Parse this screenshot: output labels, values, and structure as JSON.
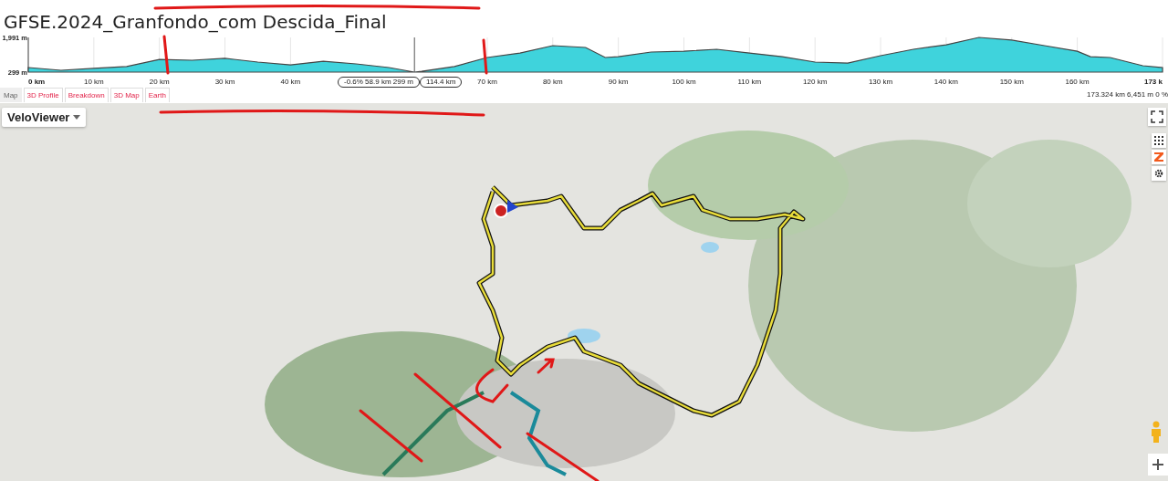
{
  "title": "GFSE.2024_Granfondo_com Descida_Final",
  "elevation_profile": {
    "chart_data": {
      "type": "area",
      "x": [
        0,
        5,
        10,
        15,
        20,
        25,
        30,
        35,
        40,
        45,
        50,
        55,
        58.9,
        60,
        65,
        70,
        75,
        80,
        85,
        88,
        90,
        95,
        100,
        105,
        110,
        115,
        120,
        125,
        130,
        135,
        140,
        145,
        150,
        155,
        160,
        162,
        165,
        170,
        173
      ],
      "series": [
        {
          "color": "#3fd3dc",
          "values": [
            520,
            390,
            480,
            570,
            920,
            880,
            970,
            790,
            650,
            830,
            700,
            520,
            299,
            340,
            570,
            1010,
            1230,
            1590,
            1500,
            1010,
            1050,
            1280,
            1320,
            1410,
            1230,
            1050,
            790,
            740,
            1100,
            1410,
            1630,
            1991,
            1860,
            1590,
            1320,
            1050,
            1010,
            610,
            520
          ]
        }
      ],
      "grid": true,
      "xlim": [
        0,
        173
      ],
      "ylim": [
        299,
        1991
      ],
      "xticks": [
        {
          "value": 0,
          "label": "0 km"
        },
        {
          "value": 10,
          "label": "10 km"
        },
        {
          "value": 20,
          "label": "20 km"
        },
        {
          "value": 30,
          "label": "30 km"
        },
        {
          "value": 40,
          "label": "40 km"
        },
        {
          "value": 70,
          "label": "70 km"
        },
        {
          "value": 80,
          "label": "80 km"
        },
        {
          "value": 90,
          "label": "90 km"
        },
        {
          "value": 100,
          "label": "100 km"
        },
        {
          "value": 110,
          "label": "110 km"
        },
        {
          "value": 120,
          "label": "120 km"
        },
        {
          "value": 130,
          "label": "130 km"
        },
        {
          "value": 140,
          "label": "140 km"
        },
        {
          "value": 150,
          "label": "150 km"
        },
        {
          "value": 160,
          "label": "160 km"
        },
        {
          "value": 173,
          "label": "173 k"
        }
      ],
      "yticks": [
        {
          "value": 299,
          "label": "299 m"
        },
        {
          "value": 1991,
          "label": "1,991 m"
        }
      ]
    },
    "cursor": {
      "readout": "-0.6% 58.9 km 299 m",
      "distance": "114.4 km"
    }
  },
  "tabs": [
    {
      "label": "Map",
      "selected": true
    },
    {
      "label": "3D Profile",
      "selected": false
    },
    {
      "label": "Breakdown",
      "selected": false
    },
    {
      "label": "3D Map",
      "selected": false
    },
    {
      "label": "Earth",
      "selected": false
    }
  ],
  "summary": "173.324 km 6,451 m 0 %",
  "map": {
    "layer_menu": "VeloViewer"
  }
}
